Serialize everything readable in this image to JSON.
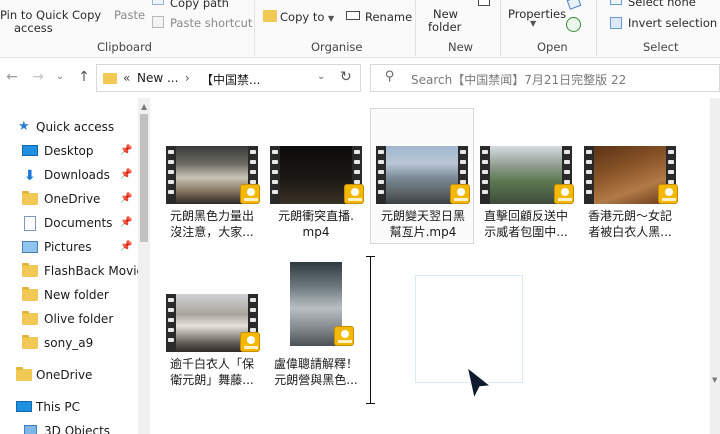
{
  "ribbon": {
    "clipboard": {
      "pin_label_1": "Pin to Quick",
      "pin_label_2": "access",
      "copy_label": "Copy",
      "paste_label": "Paste",
      "copy_path_label": "Copy path",
      "paste_shortcut_label": "Paste shortcut",
      "group_label": "Clipboard"
    },
    "organise": {
      "copy_to_label": "Copy to",
      "rename_label": "Rename",
      "group_label": "Organise"
    },
    "new": {
      "new_folder_label_1": "New",
      "new_folder_label_2": "folder",
      "group_label": "New"
    },
    "open": {
      "properties_label": "Properties",
      "group_label": "Open"
    },
    "select": {
      "select_none_label": "Select none",
      "invert_selection_label": "Invert selection",
      "group_label": "Select"
    }
  },
  "address": {
    "path_prefix": "«",
    "path_seg1": "New ...",
    "path_sep": "›",
    "path_seg2": "【中国禁...",
    "search_placeholder": "Search【中国禁闻】7月21日完整版 22"
  },
  "nav": {
    "quick_access": "Quick access",
    "items": [
      {
        "label": "Desktop",
        "pinned": true
      },
      {
        "label": "Downloads",
        "pinned": true
      },
      {
        "label": "OneDrive",
        "pinned": true
      },
      {
        "label": "Documents",
        "pinned": true
      },
      {
        "label": "Pictures",
        "pinned": true
      },
      {
        "label": "FlashBack Movies",
        "pinned": false
      },
      {
        "label": "New folder",
        "pinned": false
      },
      {
        "label": "Olive folder",
        "pinned": false
      },
      {
        "label": "sony_a9",
        "pinned": false
      }
    ],
    "onedrive": "OneDrive",
    "this_pc": "This PC",
    "objects_3d": "3D Objects"
  },
  "files": [
    {
      "line1": "元朗黑色力量出",
      "line2": "沒注意，大家...",
      "selected": false
    },
    {
      "line1": "元朗衝突直播.",
      "line2": "mp4",
      "selected": false
    },
    {
      "line1": "元朗變天翌日黑",
      "line2": "幫亙片.mp4",
      "selected": true
    },
    {
      "line1": "直擊回顧反送中",
      "line2": "示威者包圍中...",
      "selected": false
    },
    {
      "line1": "香港元朗～女記",
      "line2": "者被白衣人黑...",
      "selected": false
    },
    {
      "line1": "逾千白衣人「保",
      "line2": "衛元朗」舞藤...",
      "selected": false
    },
    {
      "line1": "盧偉聰請解釋！",
      "line2": "元朗營與黑色...",
      "selected": false
    }
  ],
  "badge_text": "Player",
  "colors": {
    "folder": "#f2c955",
    "badge": "#f5b800",
    "accent": "#0078d7"
  }
}
